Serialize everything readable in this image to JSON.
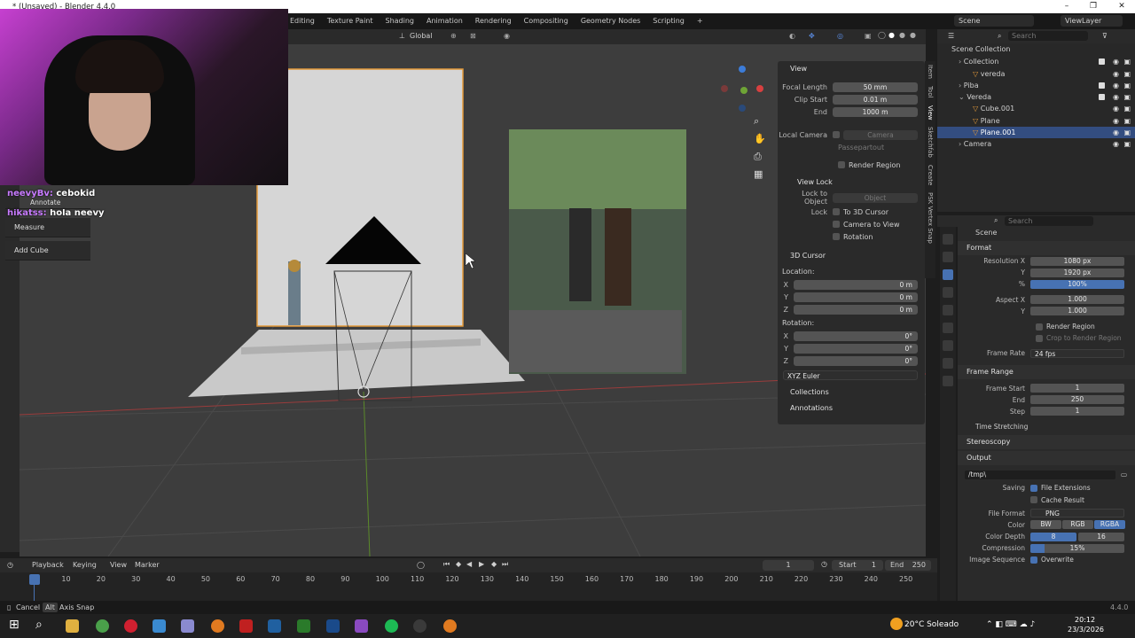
{
  "window": {
    "title": "* (Unsaved) - Blender 4.4.0",
    "minimize": "–",
    "maximize": "❐",
    "close": "✕"
  },
  "workspaces": [
    "Editing",
    "Texture Paint",
    "Shading",
    "Animation",
    "Rendering",
    "Compositing",
    "Geometry Nodes",
    "Scripting"
  ],
  "workspace_add": "+",
  "scene_name": "Scene",
  "view_layer": "ViewLayer",
  "viewport_header": {
    "orientation": "Global",
    "options": "Options"
  },
  "stream_chat": [
    {
      "user": "neevyBv:",
      "message": "cebokid"
    },
    {
      "user": "hikatss:",
      "message": "hola neevy"
    }
  ],
  "tools": [
    "Annotate",
    "Measure",
    "Add Cube"
  ],
  "npanel": {
    "view_title": "View",
    "focal_length_label": "Focal Length",
    "focal_length": "50 mm",
    "clip_start_label": "Clip Start",
    "clip_start": "0.01 m",
    "end_label": "End",
    "clip_end": "1000 m",
    "local_camera_label": "Local Camera",
    "local_camera": "Camera",
    "passepartout": "Passepartout",
    "render_region": "Render Region",
    "view_lock_title": "View Lock",
    "lock_to_object_label": "Lock to Object",
    "object_placeholder": "Object",
    "lock_label": "Lock",
    "to_3d_cursor": "To 3D Cursor",
    "camera_to_view": "Camera to View",
    "rotation": "Rotation",
    "cursor_title": "3D Cursor",
    "location_label": "Location:",
    "loc_x_label": "X",
    "loc_x": "0 m",
    "loc_y_label": "Y",
    "loc_y": "0 m",
    "loc_z_label": "Z",
    "loc_z": "0 m",
    "rotation_label": "Rotation:",
    "rot_x_label": "X",
    "rot_x": "0°",
    "rot_y_label": "Y",
    "rot_y": "0°",
    "rot_z_label": "Z",
    "rot_z": "0°",
    "rotation_mode": "XYZ Euler",
    "collections": "Collections",
    "annotations": "Annotations",
    "tabs": [
      "Item",
      "Tool",
      "View",
      "Sketchfab",
      "Create",
      "PSK Vertex Snap"
    ]
  },
  "outliner": {
    "search_placeholder": "Search",
    "rows": [
      {
        "label": "Scene Collection",
        "indent": 0,
        "selected": false
      },
      {
        "label": "Collection",
        "indent": 1,
        "selected": false
      },
      {
        "label": "vereda",
        "indent": 2,
        "selected": false
      },
      {
        "label": "Piba",
        "indent": 1,
        "selected": false
      },
      {
        "label": "Vereda",
        "indent": 1,
        "selected": false
      },
      {
        "label": "Cube.001",
        "indent": 2,
        "selected": false
      },
      {
        "label": "Plane",
        "indent": 2,
        "selected": false
      },
      {
        "label": "Plane.001",
        "indent": 2,
        "selected": true
      },
      {
        "label": "Camera",
        "indent": 1,
        "selected": false
      }
    ]
  },
  "properties": {
    "search_placeholder": "Search",
    "breadcrumb": "Scene",
    "format_title": "Format",
    "resolution_x_label": "Resolution X",
    "resolution_x": "1080 px",
    "resolution_y_label": "Y",
    "resolution_y": "1920 px",
    "percent_label": "%",
    "percent": "100%",
    "aspect_x_label": "Aspect X",
    "aspect_x": "1.000",
    "aspect_y_label": "Y",
    "aspect_y": "1.000",
    "render_region": "Render Region",
    "crop_to_render_region": "Crop to Render Region",
    "frame_rate_label": "Frame Rate",
    "frame_rate": "24 fps",
    "frame_range_title": "Frame Range",
    "frame_start_label": "Frame Start",
    "frame_start": "1",
    "end_label": "End",
    "frame_end": "250",
    "step_label": "Step",
    "step": "1",
    "time_stretching": "Time Stretching",
    "stereoscopy": "Stereoscopy",
    "output_title": "Output",
    "output_path": "/tmp\\",
    "saving_label": "Saving",
    "file_extensions": "File Extensions",
    "cache_result": "Cache Result",
    "file_format_label": "File Format",
    "file_format": "PNG",
    "color_label": "Color",
    "color_bw": "BW",
    "color_rgb": "RGB",
    "color_rgba": "RGBA",
    "color_depth_label": "Color Depth",
    "depth_8": "8",
    "depth_16": "16",
    "compression_label": "Compression",
    "compression": "15%",
    "compression_level": 0.15,
    "image_sequence_label": "Image Sequence",
    "overwrite": "Overwrite"
  },
  "timeline": {
    "menus": [
      "Playback",
      "Keying",
      "View",
      "Marker"
    ],
    "current_frame": "1",
    "start_label": "Start",
    "start": "1",
    "end_label": "End",
    "end": "250",
    "ruler": [
      "1",
      "10",
      "20",
      "30",
      "40",
      "50",
      "60",
      "70",
      "80",
      "90",
      "100",
      "110",
      "120",
      "130",
      "140",
      "150",
      "160",
      "170",
      "180",
      "190",
      "200",
      "210",
      "220",
      "230",
      "240",
      "250"
    ]
  },
  "statusbar": {
    "cancel": "Cancel",
    "alt_key": "Alt",
    "axis_snap": "Axis Snap",
    "version": "4.4.0"
  },
  "taskbar": {
    "weather": "20°C  Soleado",
    "time": "20:12",
    "date": "23/3/2026"
  }
}
